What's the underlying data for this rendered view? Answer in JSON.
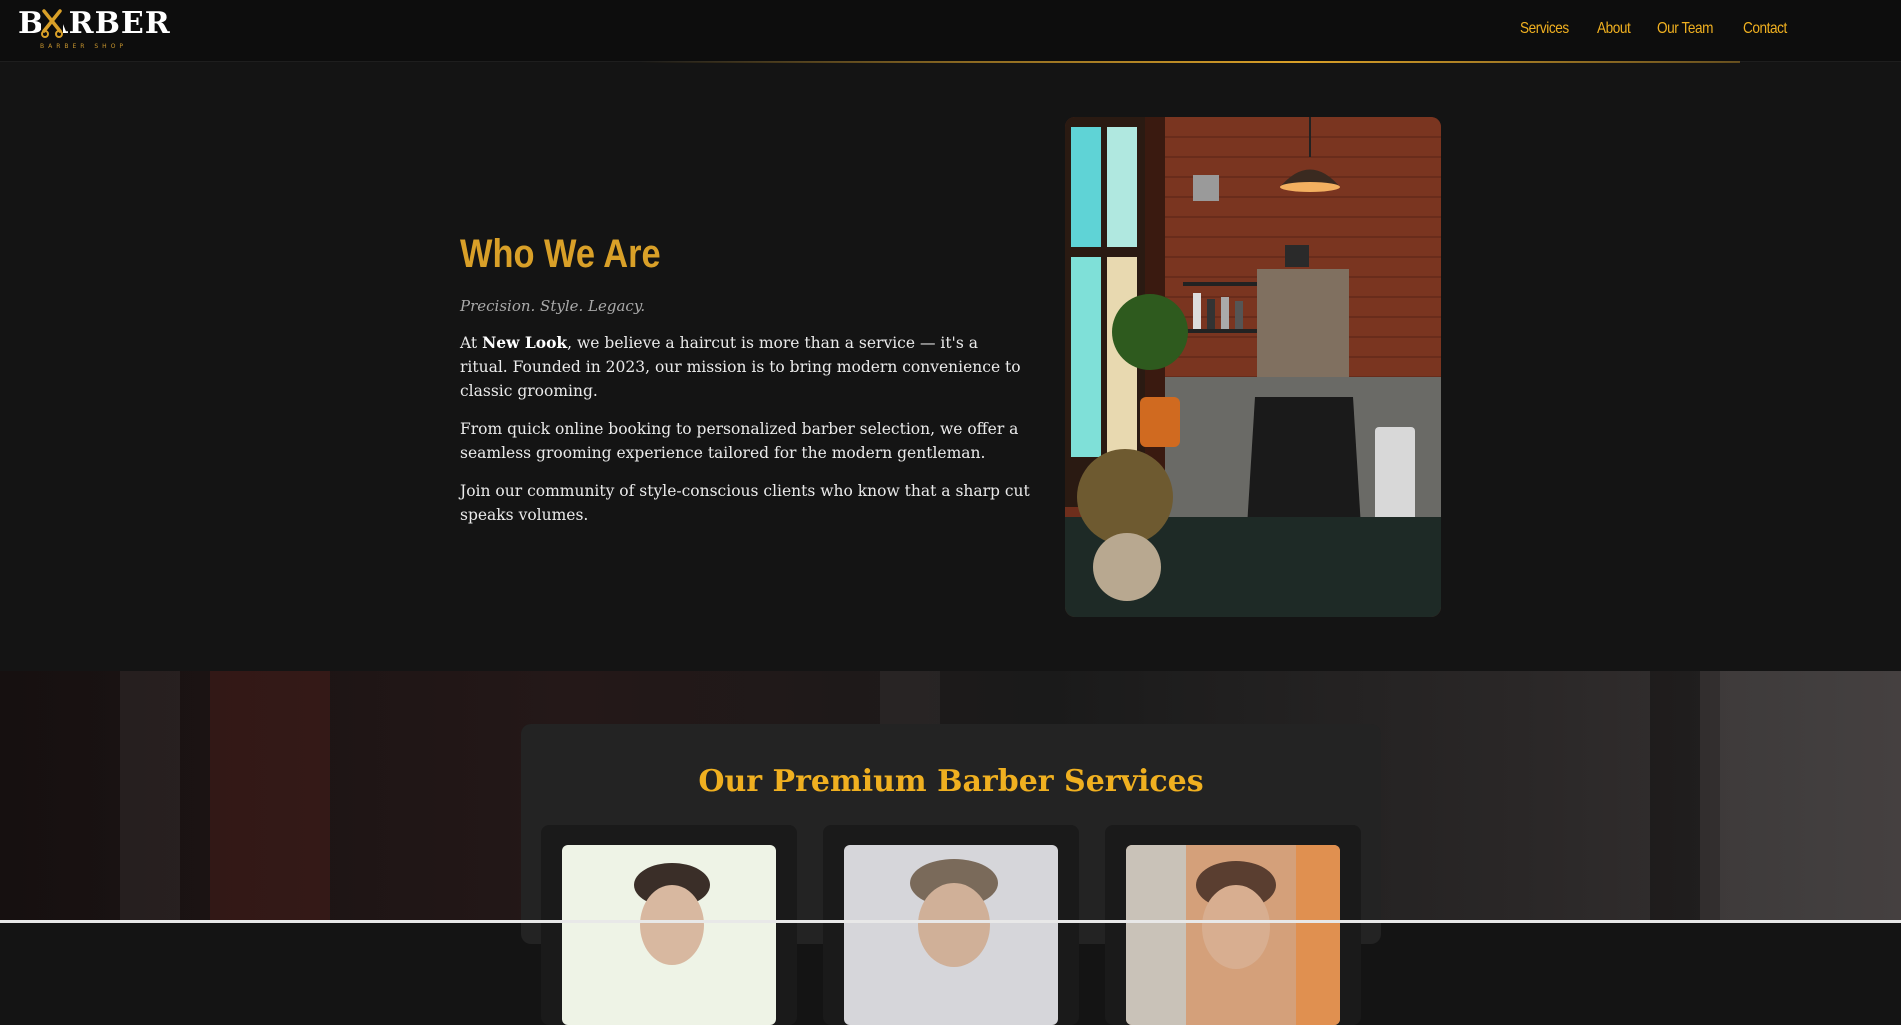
{
  "header": {
    "logo": {
      "wordmark": "BARBER",
      "subtitle": "BARBER SHOP"
    },
    "nav": [
      {
        "label": "Services"
      },
      {
        "label": "About"
      },
      {
        "label": "Our Team"
      },
      {
        "label": "Contact"
      }
    ]
  },
  "about": {
    "title": "Who We Are",
    "tagline": "Precision. Style. Legacy.",
    "p1_prefix": "At ",
    "p1_brand": "New Look",
    "p1_suffix": ", we believe a haircut is more than a service — it's a ritual. Founded in 2023, our mission is to bring modern convenience to classic grooming.",
    "p2": "From quick online booking to personalized barber selection, we offer a seamless grooming experience tailored for the modern gentleman.",
    "p3": "Join our community of style-conscious clients who know that a sharp cut speaks volumes.",
    "photo": "barbershop-interior-photo"
  },
  "services": {
    "title": "Our Premium Barber Services",
    "cards": [
      {
        "image": "haircut-photo-1"
      },
      {
        "image": "haircut-photo-2"
      },
      {
        "image": "haircut-photo-3"
      }
    ]
  },
  "colors": {
    "accent": "#f0b020",
    "accent_dark": "#d9a028",
    "background": "#141414",
    "header_bg": "#0d0d0d",
    "card_bg": "#232323"
  }
}
